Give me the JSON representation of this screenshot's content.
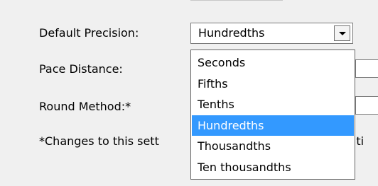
{
  "header_fragment": "",
  "labels": {
    "precision": "Default Precision:",
    "pace": "Pace Distance:",
    "round": "Round Method:*",
    "note": "*Changes to this sett",
    "note_tail": "t ti"
  },
  "precision_select": {
    "value": "Hundredths",
    "options": [
      {
        "label": "Seconds",
        "selected": false
      },
      {
        "label": "Fifths",
        "selected": false
      },
      {
        "label": "Tenths",
        "selected": false
      },
      {
        "label": "Hundredths",
        "selected": true
      },
      {
        "label": "Thousandths",
        "selected": false
      },
      {
        "label": "Ten thousandths",
        "selected": false
      }
    ]
  },
  "colors": {
    "highlight": "#3399ff",
    "window_bg": "#f0f0f0"
  }
}
